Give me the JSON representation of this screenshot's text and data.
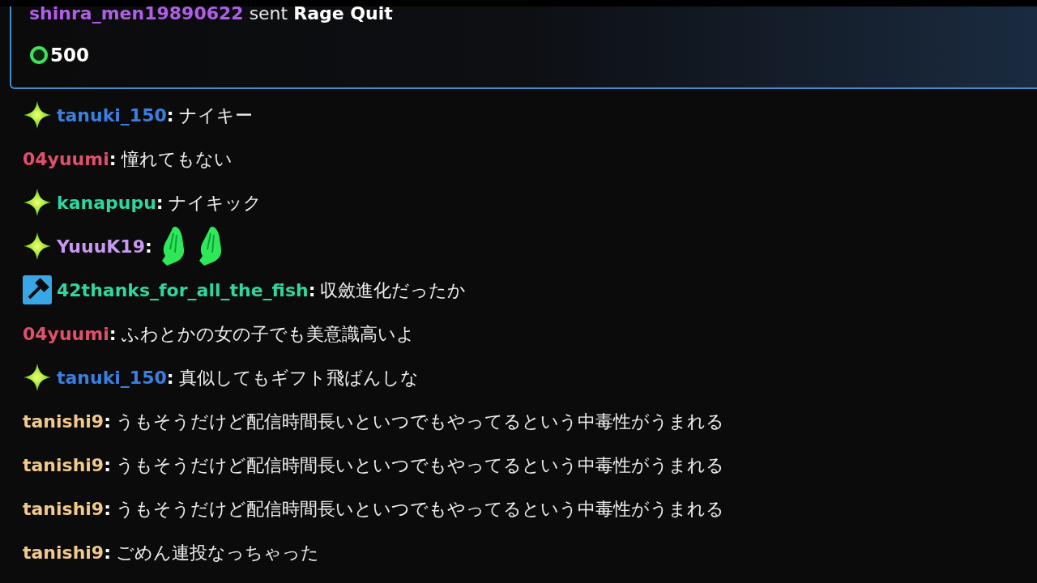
{
  "gift": {
    "sender": "shinra_men19890622",
    "color": "#b05ee8",
    "verb": "sent",
    "item": "Rage Quit",
    "amount": "500"
  },
  "messages": [
    {
      "badge": {
        "kind": "sparkle"
      },
      "user": "tanuki_150",
      "color": "#3b7fe0",
      "colon": ":",
      "parts": [
        {
          "kind": "text",
          "text": "ナイキー"
        }
      ]
    },
    {
      "user": "04yuumi",
      "color": "#e0506c",
      "colon": ":",
      "parts": [
        {
          "kind": "text",
          "text": "憧れてもない"
        }
      ]
    },
    {
      "badge": {
        "kind": "sparkle"
      },
      "user": "kanapupu",
      "color": "#2fd6a0",
      "colon": ":",
      "parts": [
        {
          "kind": "text",
          "text": "ナイキック"
        }
      ]
    },
    {
      "badge": {
        "kind": "sparkle"
      },
      "user": "YuuuK19",
      "color": "#c79af0",
      "colon": ":",
      "parts": [
        {
          "kind": "emote"
        },
        {
          "kind": "emote"
        }
      ]
    },
    {
      "badge": {
        "kind": "moderator"
      },
      "user": "42thanks_for_all_the_fish",
      "color": "#2fd6a0",
      "colon": ":",
      "parts": [
        {
          "kind": "text",
          "text": "収斂進化だったか"
        }
      ]
    },
    {
      "user": "04yuumi",
      "color": "#e0506c",
      "colon": ":",
      "parts": [
        {
          "kind": "text",
          "text": "ふわとかの女の子でも美意識高いよ"
        }
      ]
    },
    {
      "badge": {
        "kind": "sparkle"
      },
      "user": "tanuki_150",
      "color": "#3b7fe0",
      "colon": ":",
      "parts": [
        {
          "kind": "text",
          "text": "真似してもギフト飛ばんしな"
        }
      ]
    },
    {
      "user": "tanishi9",
      "color": "#f2c98a",
      "colon": ":",
      "parts": [
        {
          "kind": "text",
          "text": "うもそうだけど配信時間長いといつでもやってるという中毒性がうまれる"
        }
      ]
    },
    {
      "user": "tanishi9",
      "color": "#f2c98a",
      "colon": ":",
      "parts": [
        {
          "kind": "text",
          "text": "うもそうだけど配信時間長いといつでもやってるという中毒性がうまれる"
        }
      ]
    },
    {
      "user": "tanishi9",
      "color": "#f2c98a",
      "colon": ":",
      "parts": [
        {
          "kind": "text",
          "text": "うもそうだけど配信時間長いといつでもやってるという中毒性がうまれる"
        }
      ]
    },
    {
      "user": "tanishi9",
      "color": "#f2c98a",
      "colon": ":",
      "parts": [
        {
          "kind": "text",
          "text": "ごめん連投なっちゃった"
        }
      ]
    }
  ]
}
